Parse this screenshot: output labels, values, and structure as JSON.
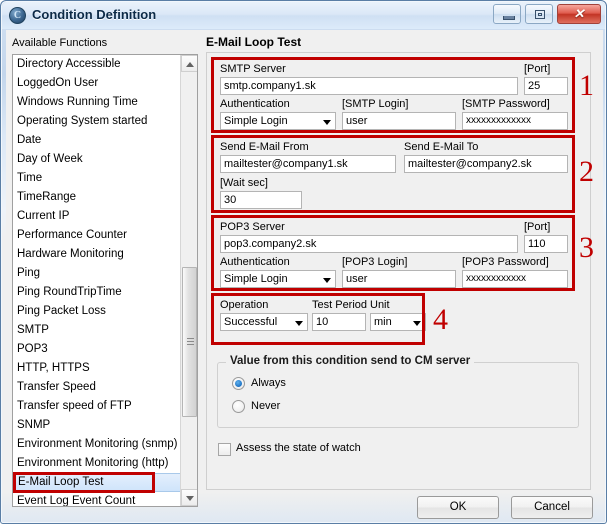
{
  "window": {
    "title": "Condition Definition",
    "icon": "app-circle-icon",
    "icon_glyph": "C",
    "minimize_label": "Minimize",
    "maximize_label": "Maximize",
    "close_label": "Close",
    "close_glyph": "✕"
  },
  "sidebar": {
    "title": "Available Functions",
    "items": [
      "Directory Accessible",
      "LoggedOn User",
      "Windows Running Time",
      "Operating System started",
      "Date",
      "Day of Week",
      "Time",
      "TimeRange",
      "Current IP",
      "Performance Counter",
      "Hardware Monitoring",
      "Ping",
      "Ping RoundTripTime",
      "Ping Packet Loss",
      "SMTP",
      "POP3",
      "HTTP, HTTPS",
      "Transfer Speed",
      "Transfer speed of FTP",
      "SNMP",
      "Environment Monitoring (snmp)",
      "Environment Monitoring (http)",
      "E-Mail Loop Test",
      "Event Log Event Count"
    ],
    "selected": "E-Mail Loop Test",
    "selected_index": 22
  },
  "main": {
    "title": "E-Mail Loop Test",
    "smtp": {
      "server_label": "SMTP Server",
      "server_value": "smtp.company1.sk",
      "port_label": "[Port]",
      "port_value": "25",
      "auth_label": "Authentication",
      "auth_value": "Simple Login",
      "login_label": "[SMTP Login]",
      "login_value": "user",
      "password_label": "[SMTP Password]",
      "password_value": "xxxxxxxxxxxxx"
    },
    "mail": {
      "from_label": "Send E-Mail From",
      "from_value": "mailtester@company1.sk",
      "to_label": "Send E-Mail To",
      "to_value": "mailtester@company2.sk",
      "wait_label": "[Wait sec]",
      "wait_value": "30"
    },
    "pop3": {
      "server_label": "POP3 Server",
      "server_value": "pop3.company2.sk",
      "port_label": "[Port]",
      "port_value": "110",
      "auth_label": "Authentication",
      "auth_value": "Simple Login",
      "login_label": "[POP3 Login]",
      "login_value": "user",
      "password_label": "[POP3 Password]",
      "password_value": "xxxxxxxxxxxx"
    },
    "operation": {
      "operation_label": "Operation",
      "operation_value": "Successful",
      "period_label": "Test Period",
      "period_value": "10",
      "unit_label": "Unit",
      "unit_value": "min"
    },
    "cm": {
      "caption": "Value from this condition send to CM server",
      "always_label": "Always",
      "never_label": "Never",
      "selected": "Always"
    },
    "assess_label": "Assess the state of watch",
    "assess_checked": false
  },
  "annotations": {
    "one": "1",
    "two": "2",
    "three": "3",
    "four": "4",
    "color": "#c00000"
  },
  "footer": {
    "ok_label": "OK",
    "cancel_label": "Cancel"
  }
}
